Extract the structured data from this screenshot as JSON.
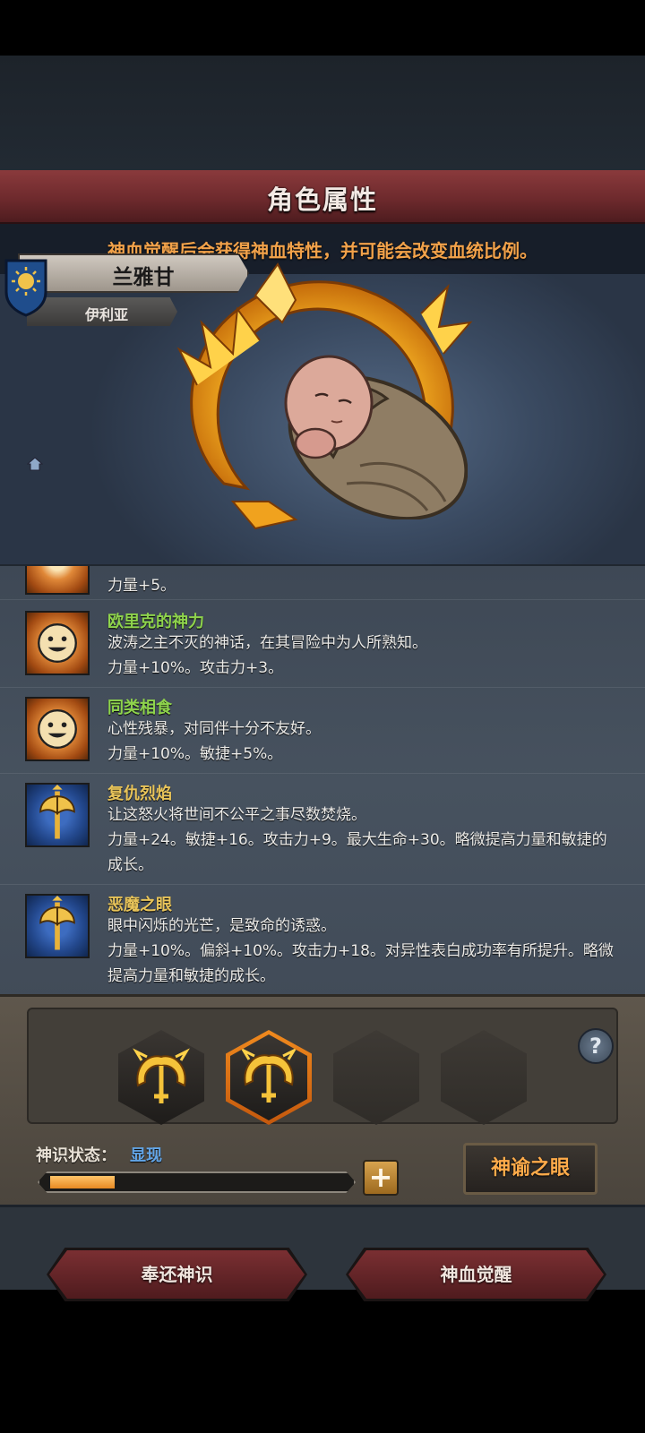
{
  "header": {
    "title": "角色属性"
  },
  "portrait": {
    "notice": "神血觉醒后会获得神血特性，并可能会改变血统比例。",
    "character_name": "兰雅甘",
    "origin": "伊利亚"
  },
  "traits": {
    "partial": {
      "effect": "力量+5。"
    },
    "items": [
      {
        "icon": "smile-face-icon",
        "name": "欧里克的神力",
        "name_color": "#8ed34c",
        "desc": "波涛之主不灭的神话，在其冒险中为人所熟知。",
        "effect": "力量+10%。攻击力+3。"
      },
      {
        "icon": "smile-face-icon",
        "name": "同类相食",
        "name_color": "#8ed34c",
        "desc": "心性残暴，对同伴十分不友好。",
        "effect": "力量+10%。敏捷+5%。"
      },
      {
        "icon": "golden-axe-icon",
        "name": "复仇烈焰",
        "name_color": "#e8c45a",
        "desc": "让这怒火将世间不公平之事尽数焚烧。",
        "effect": "力量+24。敏捷+16。攻击力+9。最大生命+30。略微提高力量和敏捷的成长。"
      },
      {
        "icon": "golden-axe-icon",
        "name": "恶魔之眼",
        "name_color": "#e8c45a",
        "desc": "眼中闪烁的光芒，是致命的诱惑。",
        "effect": "力量+10%。偏斜+10%。攻击力+18。对异性表白成功率有所提升。略微提高力量和敏捷的成长。"
      }
    ]
  },
  "awakening": {
    "slots": [
      "filled",
      "selected",
      "empty",
      "empty"
    ],
    "help": "?",
    "status_label": "神识状态：",
    "status_value": "显现",
    "progress": 0.22,
    "plus": "+",
    "oracle_button": "神谕之眼"
  },
  "footer": {
    "return_button": "奉还神识",
    "awaken_button": "神血觉醒"
  },
  "colors": {
    "accent_orange": "#f2a24a",
    "banner_red": "#6e2a2d",
    "status_blue": "#63a6e8"
  }
}
